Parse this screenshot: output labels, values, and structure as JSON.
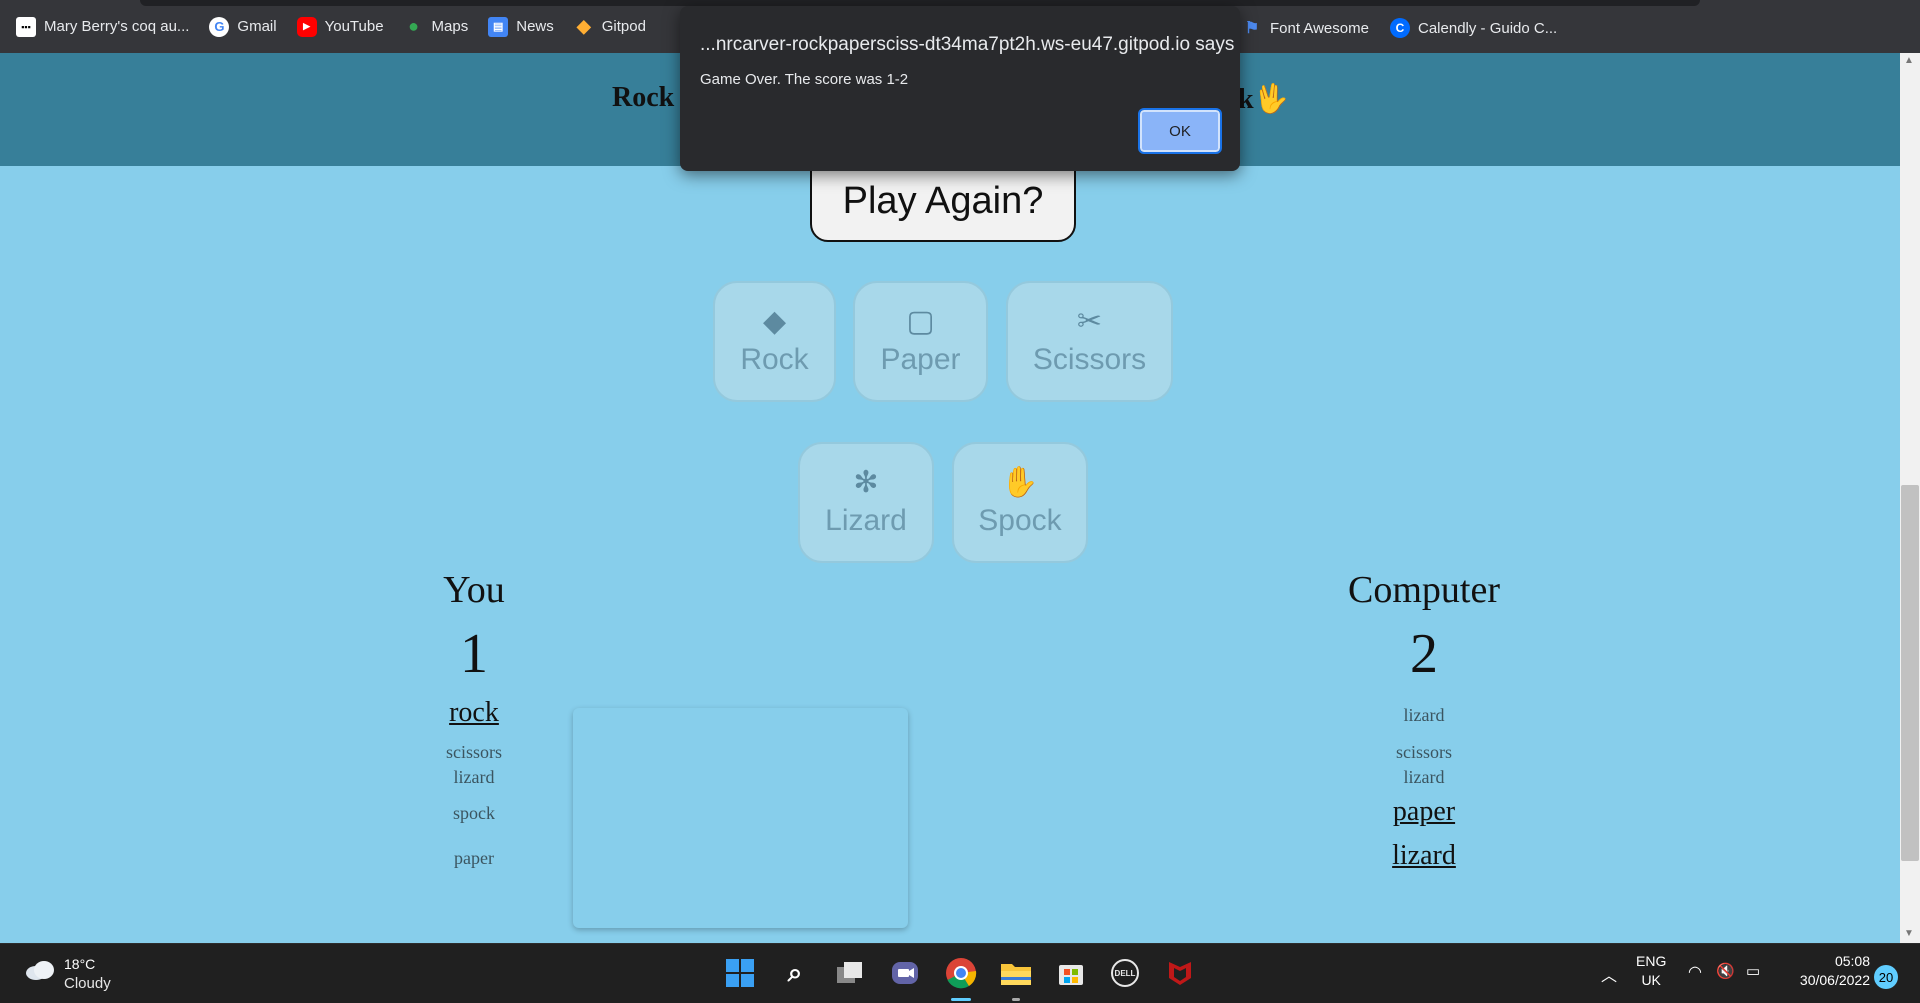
{
  "bookmarks": [
    {
      "label": "Mary Berry's coq au...",
      "icon": "bookmark-grid-icon"
    },
    {
      "label": "Gmail",
      "icon": "google-icon"
    },
    {
      "label": "YouTube",
      "icon": "youtube-icon"
    },
    {
      "label": "Maps",
      "icon": "maps-pin-icon"
    },
    {
      "label": "News",
      "icon": "news-icon"
    },
    {
      "label": "Gitpod",
      "icon": "gitpod-icon"
    }
  ],
  "bookmarks_right": [
    {
      "label": "Font Awesome",
      "icon": "flag-icon"
    },
    {
      "label": "Calendly - Guido C...",
      "icon": "calendly-icon"
    }
  ],
  "header": {
    "title_left": "Rock",
    "title_right": "k"
  },
  "play_again": "Play Again?",
  "choices": [
    {
      "label": "Rock",
      "icon": "gem-icon"
    },
    {
      "label": "Paper",
      "icon": "note-icon"
    },
    {
      "label": "Scissors",
      "icon": "scissors-icon"
    },
    {
      "label": "Lizard",
      "icon": "lizard-icon"
    },
    {
      "label": "Spock",
      "icon": "spock-hand-icon"
    }
  ],
  "player": {
    "heading": "You",
    "score": "1",
    "history": [
      "rock",
      "scissors",
      "lizard",
      "spock",
      "paper"
    ]
  },
  "computer": {
    "heading": "Computer",
    "score": "2",
    "history": [
      "lizard",
      "scissors",
      "lizard",
      "paper",
      "lizard"
    ]
  },
  "alert": {
    "title": "...nrcarver-rockpapersciss-dt34ma7pt2h.ws-eu47.gitpod.io says",
    "message": "Game Over. The score was 1-2",
    "ok_label": "OK"
  },
  "taskbar": {
    "temperature": "18°C",
    "condition": "Cloudy",
    "lang_1": "ENG",
    "lang_2": "UK",
    "time": "05:08",
    "date": "30/06/2022",
    "notifications": "20"
  },
  "colors": {
    "page_bg": "#87ceeb",
    "header_bg": "#377f99",
    "alert_bg": "#292a2d",
    "ok_button": "#8ab4f8"
  }
}
